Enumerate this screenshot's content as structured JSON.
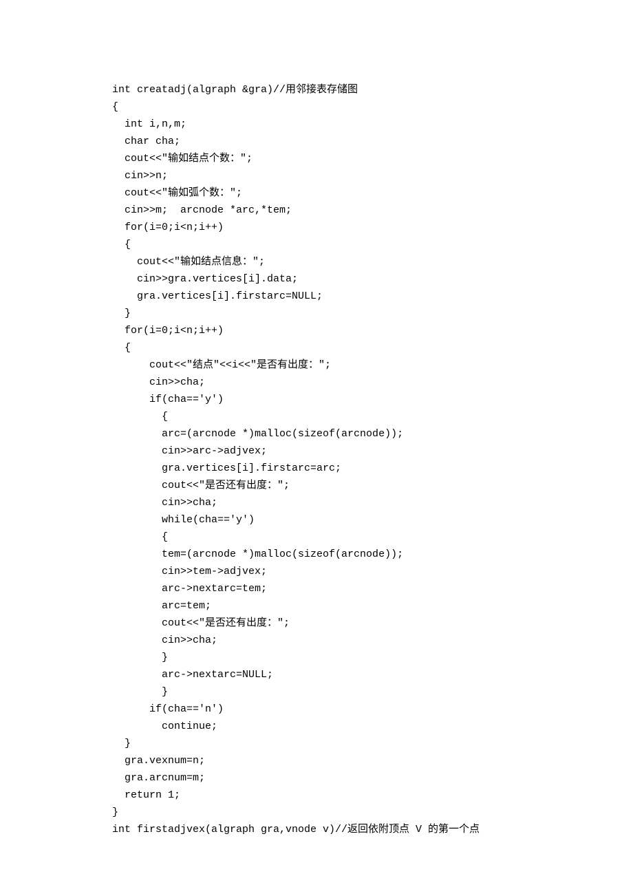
{
  "code_lines": [
    "int creatadj(algraph &gra)//用邻接表存储图",
    "{",
    "  int i,n,m;",
    "  char cha;",
    "  cout<<\"输如结点个数：\";",
    "  cin>>n;",
    "  cout<<\"输如弧个数：\";",
    "  cin>>m;  arcnode *arc,*tem;",
    "  for(i=0;i<n;i++)",
    "  {",
    "    cout<<\"输如结点信息：\";",
    "    cin>>gra.vertices[i].data;",
    "    gra.vertices[i].firstarc=NULL;",
    "  }",
    "  for(i=0;i<n;i++)",
    "  {",
    "      cout<<\"结点\"<<i<<\"是否有出度：\";",
    "      cin>>cha;",
    "      if(cha=='y')",
    "        {",
    "        arc=(arcnode *)malloc(sizeof(arcnode));",
    "        cin>>arc->adjvex;",
    "        gra.vertices[i].firstarc=arc;",
    "        cout<<\"是否还有出度：\";",
    "        cin>>cha;",
    "        while(cha=='y')",
    "        {",
    "        tem=(arcnode *)malloc(sizeof(arcnode));",
    "        cin>>tem->adjvex;",
    "        arc->nextarc=tem;",
    "        arc=tem;",
    "        cout<<\"是否还有出度：\";",
    "        cin>>cha;",
    "        }",
    "        arc->nextarc=NULL;",
    "        }",
    "      if(cha=='n')",
    "        continue;",
    "  }",
    "  gra.vexnum=n;",
    "  gra.arcnum=m;",
    "  return 1;",
    "}",
    "int firstadjvex(algraph gra,vnode v)//返回依附顶点 V 的第一个点"
  ]
}
